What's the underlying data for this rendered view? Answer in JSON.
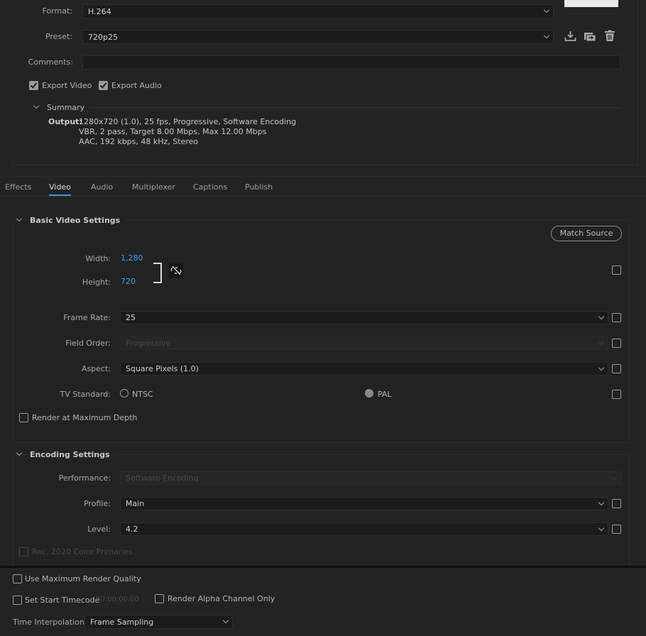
{
  "export": {
    "format_label": "Format:",
    "format_value": "H.264",
    "preset_label": "Preset:",
    "preset_value": "720p25",
    "comments_label": "Comments:",
    "comments_value": "",
    "export_video_label": "Export Video",
    "export_video_checked": true,
    "export_audio_label": "Export Audio",
    "export_audio_checked": true,
    "summary_label": "Summary",
    "output_label": "Output:",
    "output_lines": [
      "1280x720 (1.0), 25 fps, Progressive, Software Encoding",
      "VBR, 2 pass, Target 8.00 Mbps, Max 12.00 Mbps",
      "AAC, 192 kbps, 48 kHz, Stereo"
    ]
  },
  "tabs": [
    "Effects",
    "Video",
    "Audio",
    "Multiplexer",
    "Captions",
    "Publish"
  ],
  "active_tab": "Video",
  "basic_video": {
    "title": "Basic Video Settings",
    "match_source": "Match Source",
    "width_label": "Width:",
    "width_value": "1,280",
    "height_label": "Height:",
    "height_value": "720",
    "frame_rate_label": "Frame Rate:",
    "frame_rate_value": "25",
    "field_order_label": "Field Order:",
    "field_order_value": "Progressive",
    "aspect_label": "Aspect:",
    "aspect_value": "Square Pixels (1.0)",
    "tv_standard_label": "TV Standard:",
    "ntsc_label": "NTSC",
    "pal_label": "PAL",
    "tv_standard_selected": "PAL",
    "render_max_depth_label": "Render at Maximum Depth"
  },
  "encoding": {
    "title": "Encoding Settings",
    "performance_label": "Performance:",
    "performance_value": "Software Encoding",
    "profile_label": "Profile:",
    "profile_value": "Main",
    "level_label": "Level:",
    "level_value": "4.2",
    "rec2020_label": "Rec. 2020 Color Primaries"
  },
  "bottom": {
    "max_render_quality_label": "Use Maximum Render Quality",
    "start_timecode_label": "Set Start Timecode",
    "start_timecode_value": "00:00:00:00",
    "alpha_only_label": "Render Alpha Channel Only",
    "time_interp_label": "Time Interpolation:",
    "time_interp_value": "Frame Sampling"
  },
  "colors": {
    "background": "#232323",
    "accent_blue": "#3b8ee8",
    "link_value": "#4a9bef"
  },
  "icons": [
    "save-preset-icon",
    "import-preset-icon",
    "delete-preset-icon",
    "unlink-aspect-icon",
    "chevron-down-icon"
  ]
}
